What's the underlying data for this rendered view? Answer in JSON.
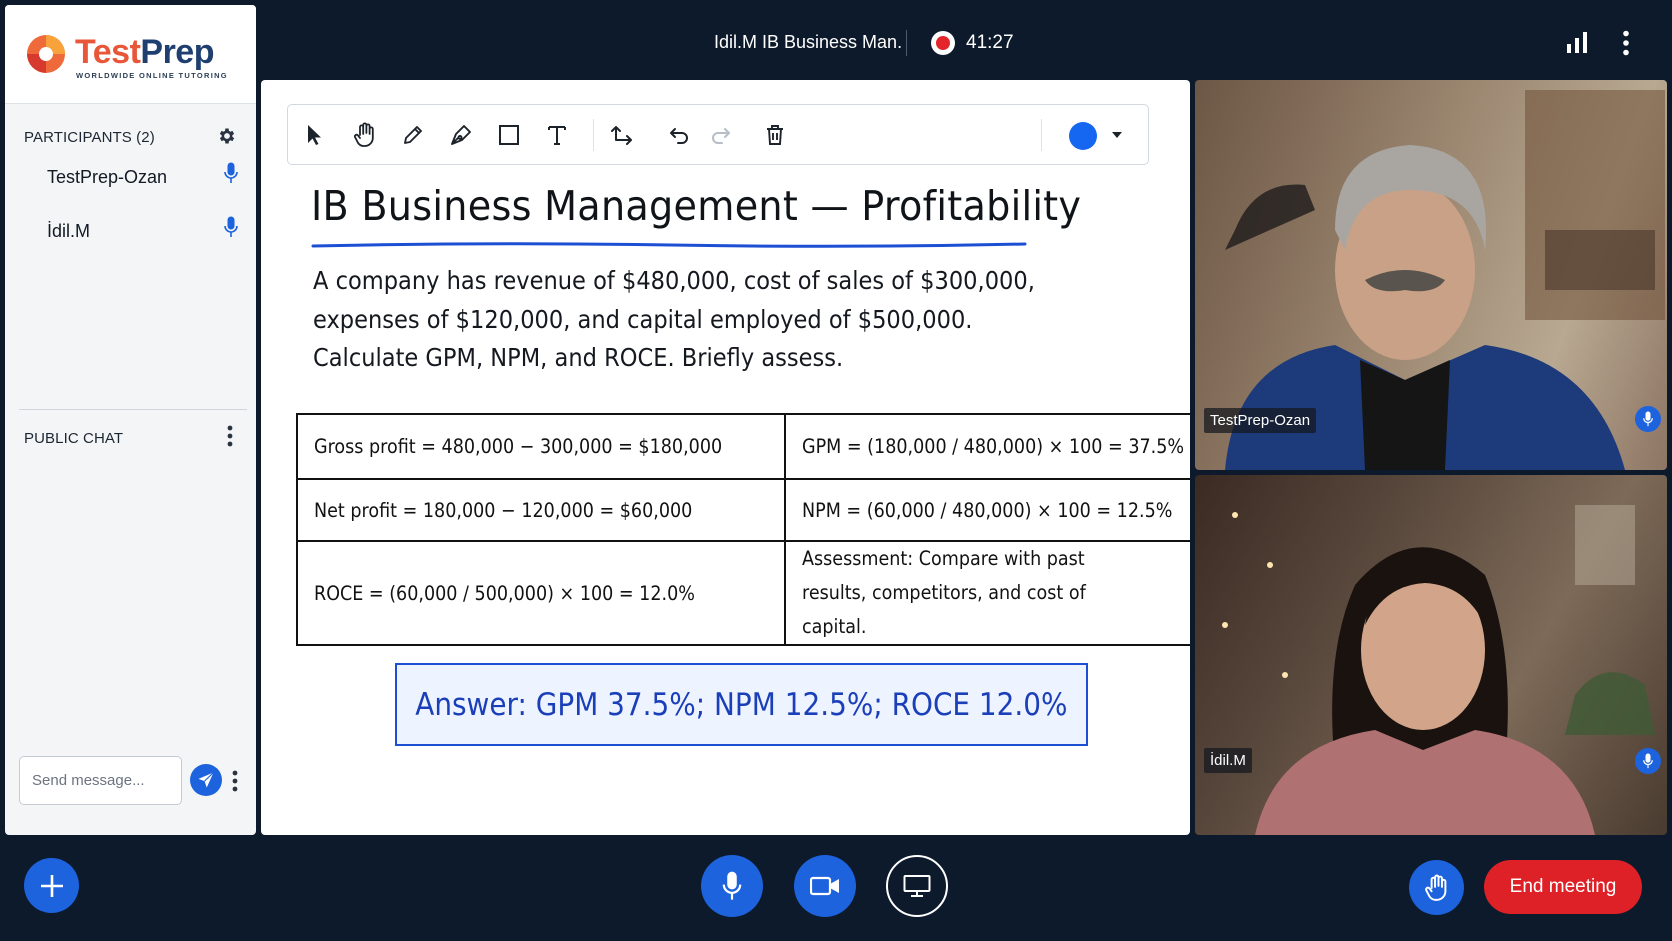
{
  "sidebar": {
    "logo": {
      "brand_a": "Test",
      "brand_b": "Prep",
      "tagline": "WORLDWIDE ONLINE TUTORING"
    },
    "participants_heading": "PARTICIPANTS (2)",
    "participants": [
      {
        "name": "TestPrep-Ozan"
      },
      {
        "name": "İdil.M"
      }
    ],
    "chat_heading": "PUBLIC CHAT",
    "chat_placeholder": "Send message..."
  },
  "topbar": {
    "meeting_title": "Idil.M IB Business Man.",
    "recording_time": "41:27"
  },
  "whiteboard": {
    "title": "IB Business Management — Profitability",
    "problem_lines": [
      "A company has revenue of $480,000, cost of sales of $300,000,",
      "expenses of $120,000, and capital employed of $500,000.",
      "Calculate GPM, NPM, and ROCE. Briefly assess."
    ],
    "table": [
      [
        "Gross profit = 480,000 − 300,000 = $180,000",
        "GPM = (180,000 / 480,000) × 100 = 37.5%"
      ],
      [
        "Net profit = 180,000 − 120,000 = $60,000",
        "NPM = (60,000 / 480,000) × 100 = 12.5%"
      ],
      [
        "ROCE = (60,000 / 500,000) × 100 = 12.0%",
        "Assessment: Compare with past results, competitors, and cost of capital."
      ]
    ],
    "answer": "Answer: GPM 37.5%; NPM 12.5%; ROCE 12.0%",
    "selected_color": "#1566f0"
  },
  "videos": [
    {
      "name": "TestPrep-Ozan"
    },
    {
      "name": "İdil.M"
    }
  ],
  "bottombar": {
    "end_meeting_label": "End meeting"
  },
  "colors": {
    "accent": "#1d63dd",
    "danger": "#dd2127",
    "background": "#0d1a2b"
  }
}
